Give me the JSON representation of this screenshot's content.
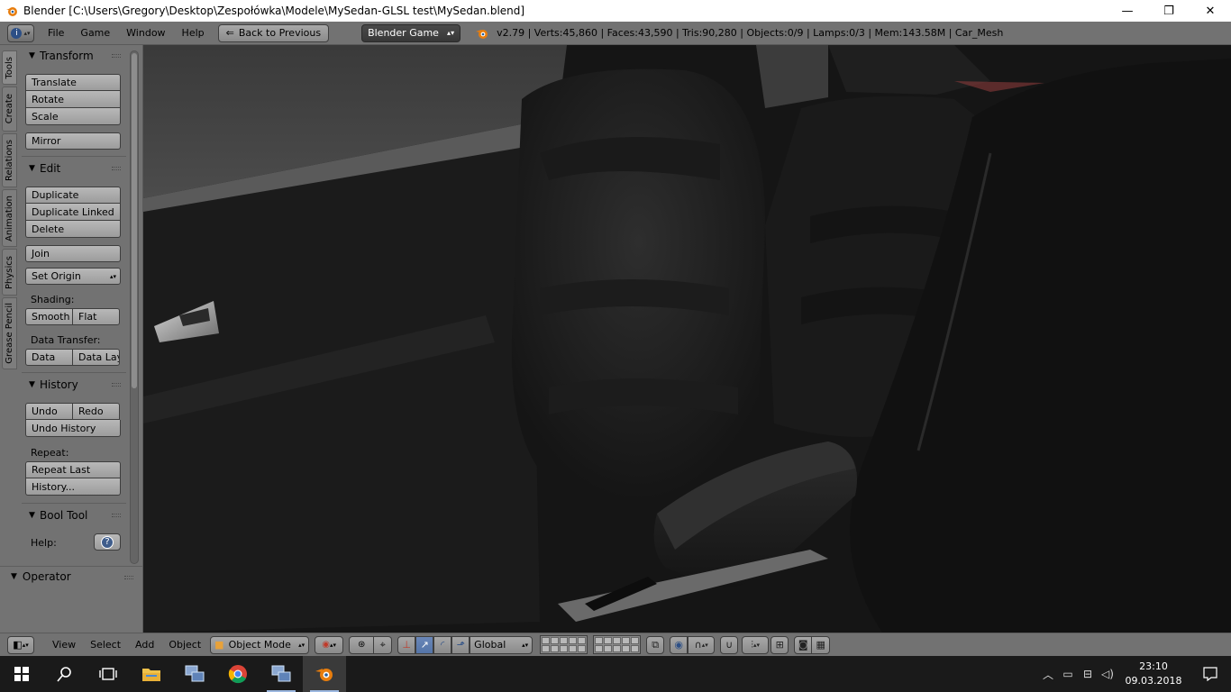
{
  "window": {
    "title": "Blender [C:\\Users\\Gregory\\Desktop\\Zespołówka\\Modele\\MySedan-GLSL test\\MySedan.blend]",
    "icon": "blender-logo",
    "controls": [
      "minimize-icon",
      "restore-icon",
      "close-icon"
    ],
    "minimize_glyph": "—",
    "restore_glyph": "❐",
    "close_glyph": "✕"
  },
  "infobar": {
    "editor_icon": "i",
    "menus": [
      "File",
      "Game",
      "Window",
      "Help"
    ],
    "back_button": "Back to Previous",
    "engine": "Blender Game",
    "stats": "v2.79 | Verts:45,860 | Faces:43,590 | Tris:90,280 | Objects:0/9 | Lamps:0/3 | Mem:143.58M | Car_Mesh"
  },
  "tabs": [
    "Tools",
    "Create",
    "Relations",
    "Animation",
    "Physics",
    "Grease Pencil"
  ],
  "panels": {
    "transform": {
      "title": "Transform",
      "buttons": [
        "Translate",
        "Rotate",
        "Scale"
      ],
      "mirror": "Mirror"
    },
    "edit": {
      "title": "Edit",
      "buttons": [
        "Duplicate",
        "Duplicate Linked",
        "Delete"
      ],
      "join": "Join",
      "set_origin": "Set Origin",
      "shading_label": "Shading:",
      "shading": [
        "Smooth",
        "Flat"
      ],
      "data_transfer_label": "Data Transfer:",
      "data_transfer": [
        "Data",
        "Data Lay"
      ]
    },
    "history": {
      "title": "History",
      "undo": "Undo",
      "redo": "Redo",
      "undo_history": "Undo History",
      "repeat_label": "Repeat:",
      "repeat_last": "Repeat Last",
      "history_more": "History..."
    },
    "bool_tool": {
      "title": "Bool Tool",
      "help_label": "Help:",
      "help_icon": "?"
    },
    "operator": {
      "title": "Operator"
    }
  },
  "view3d_header": {
    "menus": [
      "View",
      "Select",
      "Add",
      "Object"
    ],
    "mode": "Object Mode",
    "orientation": "Global"
  },
  "taskbar": {
    "apps": [
      "start-icon",
      "search-icon",
      "task-view-icon",
      "file-explorer-icon",
      "app-window-icon",
      "chrome-icon",
      "app-window-2-icon",
      "blender-icon"
    ],
    "time": "23:10",
    "date": "09.03.2018"
  },
  "colors": {
    "blender_panel": "#727272",
    "viewport_bg": "#161616",
    "taskbar": "#1a1a1a",
    "accent_blue": "#5475a8"
  }
}
